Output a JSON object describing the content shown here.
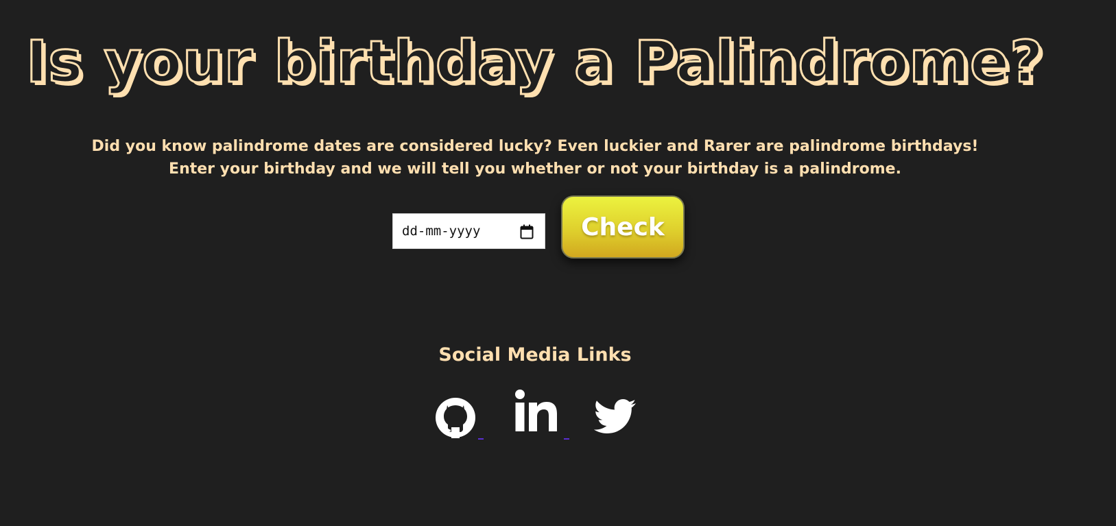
{
  "header": {
    "title": "Is your birthday a Palindrome?"
  },
  "intro": {
    "text": "Did you know palindrome dates are considered lucky? Even luckier and Rarer are palindrome birthdays! Enter your birthday and we will tell you whether or not your birthday is a palindrome."
  },
  "form": {
    "date_placeholder": "dd-mm-yyyy",
    "date_value": "",
    "calendar_icon": "calendar-icon",
    "check_label": "Check"
  },
  "social": {
    "heading": "Social Media Links",
    "links": [
      {
        "icon": "github-icon"
      },
      {
        "icon": "linkedin-icon"
      },
      {
        "icon": "twitter-icon"
      }
    ]
  },
  "colors": {
    "background": "#1f1f1f",
    "text_accent": "#ffdfb0",
    "button_top": "#ecf23f",
    "button_bottom": "#d1a81f",
    "link_underline": "#5a2fd1"
  }
}
